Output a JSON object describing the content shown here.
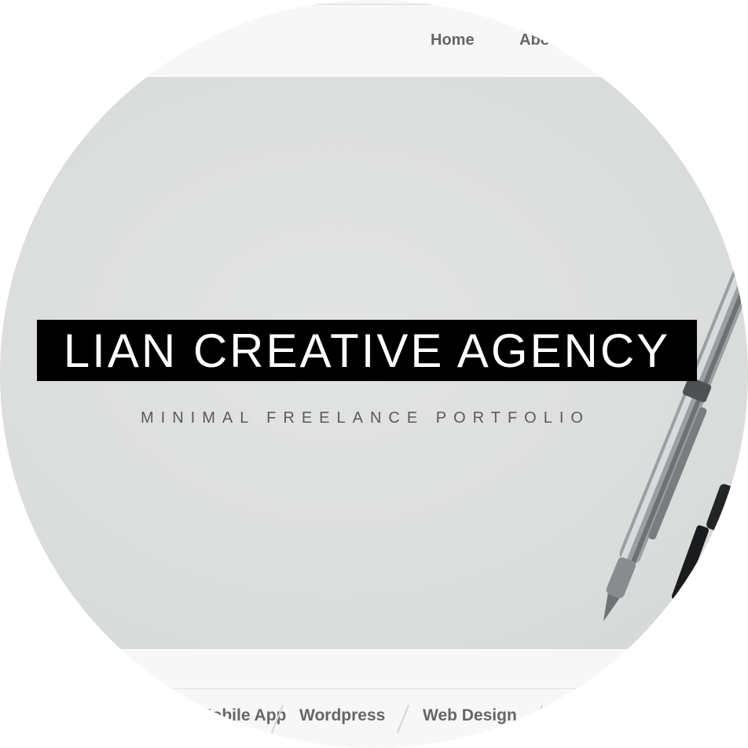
{
  "nav": {
    "items": [
      {
        "label": "Home"
      },
      {
        "label": "Abo"
      }
    ]
  },
  "hero": {
    "title": "LIAN CREATIVE AGENCY",
    "subtitle": "MINIMAL FREELANCE PORTFOLIO"
  },
  "filters": {
    "items": [
      {
        "label": "Mobile App"
      },
      {
        "label": "Wordpress"
      },
      {
        "label": "Web Design"
      }
    ]
  },
  "colors": {
    "nav_text": "#666666",
    "title_bg": "#000000",
    "title_text": "#ffffff",
    "hero_bg": "#dcdedd",
    "bar_bg": "#f7f7f7"
  }
}
